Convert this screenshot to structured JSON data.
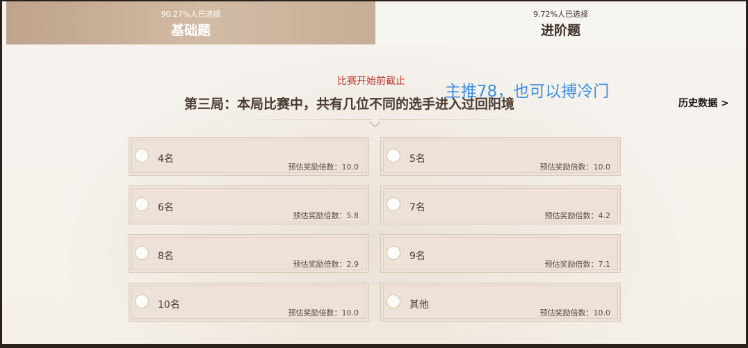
{
  "tabs": [
    {
      "pct": "90.27%人已选择",
      "title": "基础题"
    },
    {
      "pct": "9.72%人已选择",
      "title": "进阶题"
    }
  ],
  "deadline": "比赛开始前截止",
  "overlay_text": "主推78，也可以搏冷门",
  "question": "第三局：本局比赛中，共有几位不同的选手进入过回阳境",
  "history_link": "历史数据 >",
  "options": [
    {
      "label": "4名",
      "odds": "预估奖励倍数：10.0"
    },
    {
      "label": "5名",
      "odds": "预估奖励倍数：10.0"
    },
    {
      "label": "6名",
      "odds": "预估奖励倍数：5.8"
    },
    {
      "label": "7名",
      "odds": "预估奖励倍数：4.2"
    },
    {
      "label": "8名",
      "odds": "预估奖励倍数：2.9"
    },
    {
      "label": "9名",
      "odds": "预估奖励倍数：7.1"
    },
    {
      "label": "10名",
      "odds": "预估奖励倍数：10.0"
    },
    {
      "label": "其他",
      "odds": "预估奖励倍数：10.0"
    }
  ]
}
